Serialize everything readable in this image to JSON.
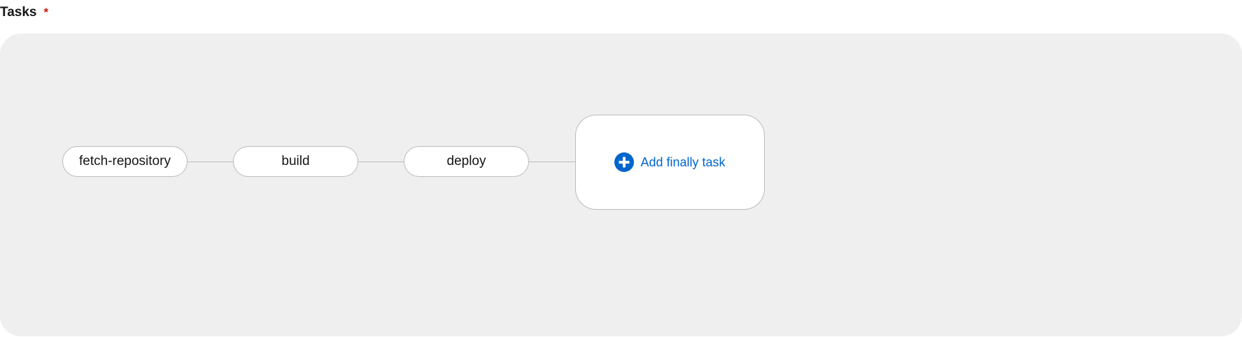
{
  "field": {
    "label": "Tasks",
    "required_marker": "*"
  },
  "pipeline": {
    "tasks": [
      {
        "name": "fetch-repository"
      },
      {
        "name": "build"
      },
      {
        "name": "deploy"
      }
    ],
    "finally": {
      "add_label": "Add finally task",
      "icon": "plus-circle-icon"
    }
  },
  "colors": {
    "canvas_background": "#efefef",
    "node_border": "#b8bbbe",
    "link_blue": "#0066cc",
    "required_red": "#c9190b"
  }
}
